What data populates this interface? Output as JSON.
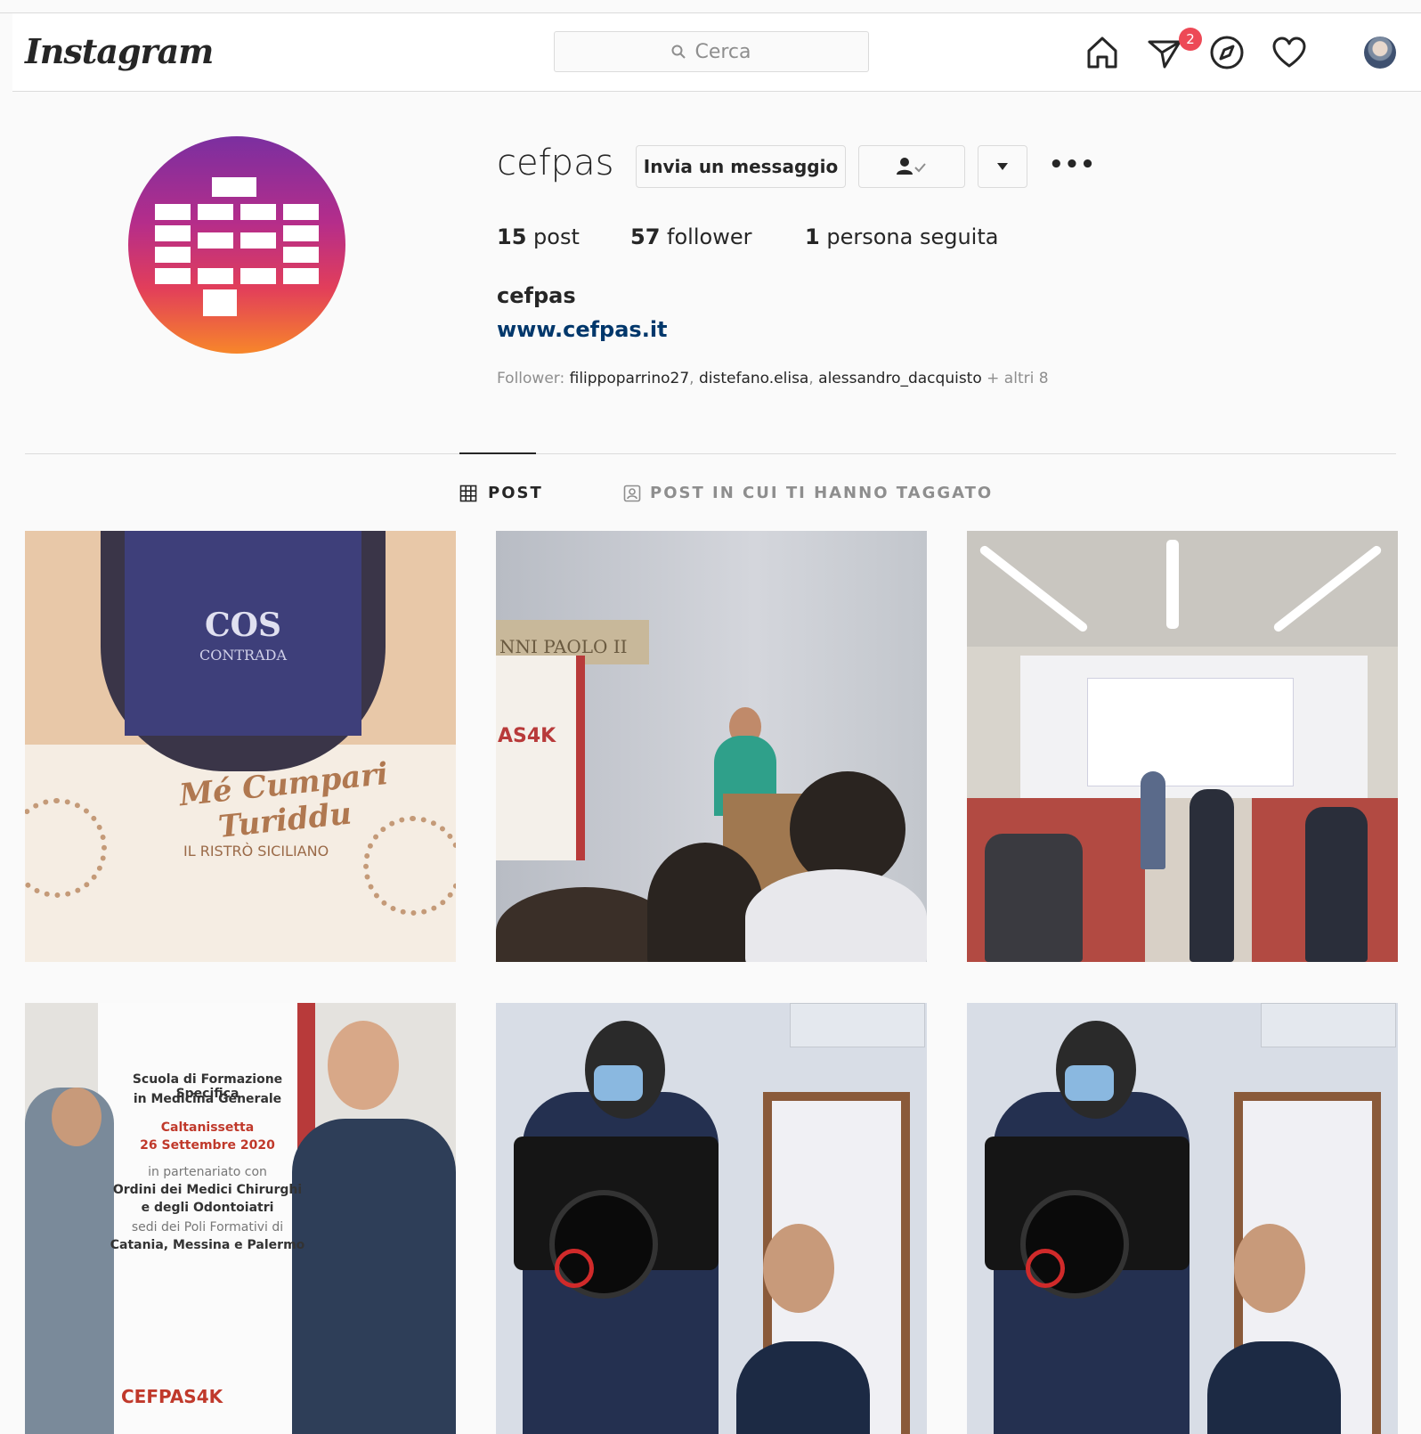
{
  "navbar": {
    "logo": "Instagram",
    "search_placeholder": "Cerca",
    "icons": [
      "home-icon",
      "direct-icon",
      "explore-icon",
      "activity-heart-icon",
      "avatar"
    ],
    "direct_badge": "2"
  },
  "profile": {
    "username": "cefpas",
    "message_button": "Invia un messaggio",
    "more_label": "•••",
    "stats": {
      "posts_count": "15",
      "posts_label": "post",
      "followers_count": "57",
      "followers_label": "follower",
      "following_count": "1",
      "following_label": "persona seguita"
    },
    "full_name": "cefpas",
    "website": "www.cefpas.it",
    "followed_by": {
      "prefix": "Follower:",
      "names": [
        "filippoparrino27",
        "distefano.elisa",
        "alessandro_dacquisto"
      ],
      "suffix": "+ altri 8"
    }
  },
  "tabs": [
    {
      "label": "POST",
      "active": true
    },
    {
      "label": "POST IN CUI TI HANNO TAGGATO",
      "active": false
    }
  ],
  "posts": {
    "p1": {
      "cos": "COS",
      "contrada": "CONTRADA",
      "brand_line1": "Mé Cumpari",
      "brand_line2": "Turiddu",
      "subtitle": "IL RISTRÒ SICILIANO"
    },
    "p2": {
      "sign": "NNI PAOLO II",
      "banner": "AS4K"
    },
    "p4": {
      "title_line1": "Scuola di Formazione Specifica",
      "title_line2": "in Medicina Generale",
      "city": "Caltanissetta",
      "date": "26 Settembre 2020",
      "partnership": "in partenariato con",
      "orders_line1": "Ordini dei Medici Chirurghi",
      "orders_line2": "e degli Odontoiatri",
      "poles": "sedi dei Poli Formativi di",
      "cities": "Catania, Messina e Palermo",
      "brand": "CEFPAS4K"
    }
  },
  "colors": {
    "badge": "#ed4956",
    "link": "#00376b",
    "avatar_gradient": [
      "#7b2fa0",
      "#b52d8a",
      "#e23e5a",
      "#f7862a"
    ]
  }
}
